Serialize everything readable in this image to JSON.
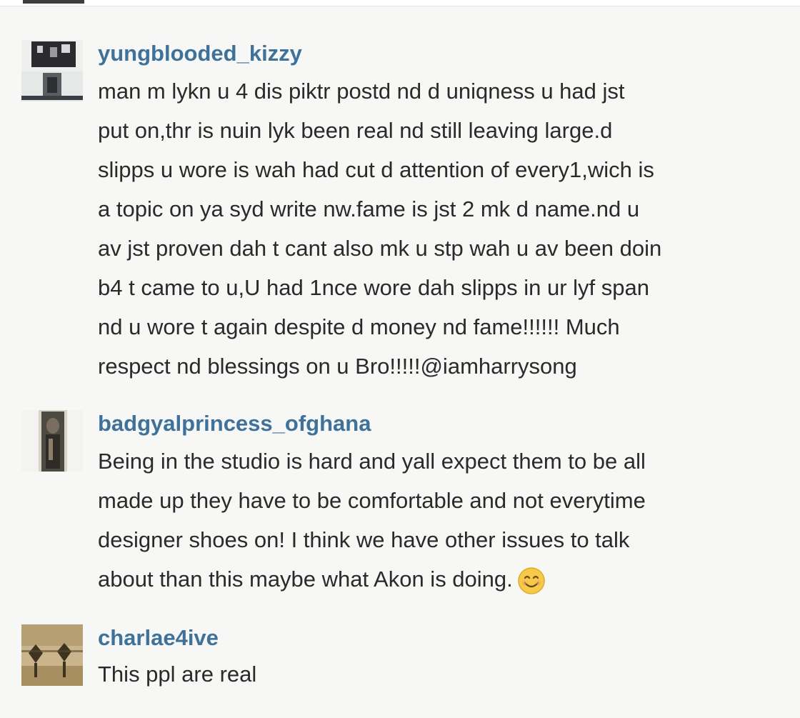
{
  "comments": [
    {
      "username": "yungblooded_kizzy",
      "lines": [
        "man m lykn u 4 dis piktr postd nd d uniqness u had jst",
        "put on,thr is nuin lyk been real nd still leaving large.d",
        "slipps u wore is wah had cut d attention of every1,wich is",
        "a topic on ya syd write nw.fame is jst 2 mk d name.nd u",
        "av jst proven dah t cant also mk u stp wah u av been doin",
        "b4 t came to u,U had 1nce wore dah slipps in ur lyf span",
        "nd u wore t again despite d money nd fame!!!!!! Much",
        "respect nd blessings on u Bro!!!!!@iamharrysong"
      ],
      "avatar_icon": "user-avatar-photo"
    },
    {
      "username": "badgyalprincess_ofghana",
      "lines": [
        "Being in the studio is hard and yall expect them to be all",
        "made up they have to be comfortable and not everytime",
        "designer shoes on! I think we have other issues to talk",
        "about than this maybe what Akon is doing."
      ],
      "emoji": "smiling-face-emoji",
      "avatar_icon": "user-avatar-photo"
    },
    {
      "username": "charlae4ive",
      "lines": [
        "This ppl are real"
      ],
      "avatar_icon": "user-avatar-photo"
    }
  ],
  "colors": {
    "username": "#3f729b",
    "text": "#2a2a2a",
    "background": "#f7f7f5"
  }
}
